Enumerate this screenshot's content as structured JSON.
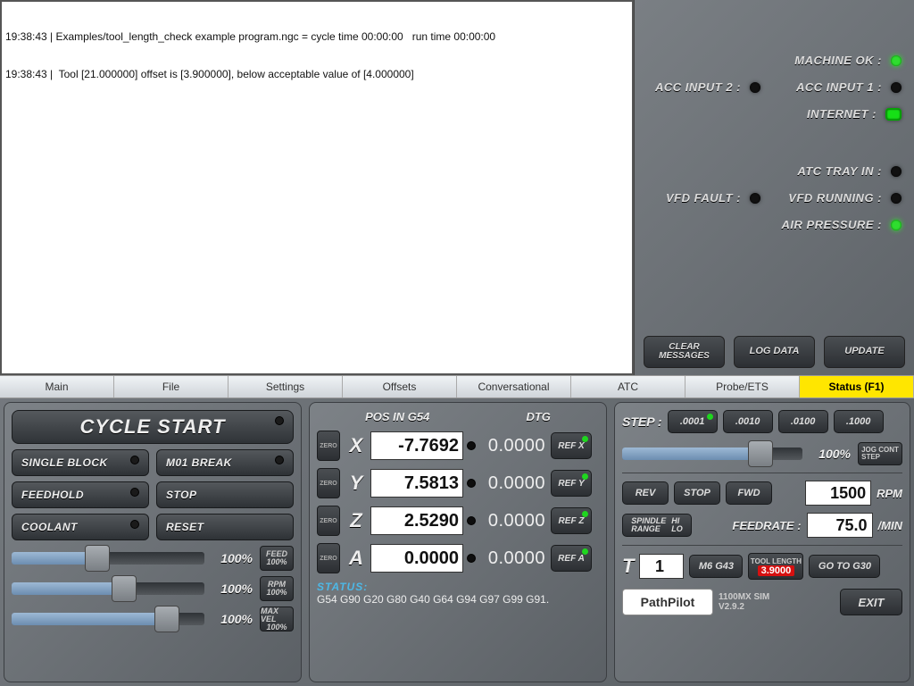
{
  "log": {
    "lines": [
      "19:38:43 | Examples/tool_length_check example program.ngc = cycle time 00:00:00   run time 00:00:00",
      "19:38:43 |  Tool [21.000000] offset is [3.900000], below acceptable value of [4.000000]"
    ]
  },
  "status_leds": {
    "machine_ok": {
      "label": "MACHINE OK :",
      "on": true
    },
    "acc_input_2": {
      "label": "ACC INPUT 2 :",
      "on": false
    },
    "acc_input_1": {
      "label": "ACC INPUT 1 :",
      "on": false
    },
    "internet": {
      "label": "INTERNET :",
      "on": true
    },
    "atc_tray_in": {
      "label": "ATC TRAY IN :",
      "on": false
    },
    "vfd_fault": {
      "label": "VFD FAULT :",
      "on": false
    },
    "vfd_running": {
      "label": "VFD RUNNING :",
      "on": false
    },
    "air_pressure": {
      "label": "AIR PRESSURE :",
      "on": true
    }
  },
  "status_buttons": {
    "clear": "CLEAR\nMESSAGES",
    "log": "LOG DATA",
    "update": "UPDATE"
  },
  "tabs": [
    "Main",
    "File",
    "Settings",
    "Offsets",
    "Conversational",
    "ATC",
    "Probe/ETS",
    "Status (F1)"
  ],
  "active_tab": 7,
  "controls": {
    "cycle_start": "CYCLE START",
    "single_block": "SINGLE BLOCK",
    "m01": "M01 BREAK",
    "feedhold": "FEEDHOLD",
    "stop": "STOP",
    "coolant": "COOLANT",
    "reset": "RESET",
    "feed_pct": "100%",
    "rpm_pct": "100%",
    "maxvel_pct": "100%",
    "feed_tag": "FEED",
    "rpm_tag": "RPM",
    "maxvel_tag": "MAX VEL",
    "hundred": "100%"
  },
  "dro": {
    "pos_label": "POS IN G54",
    "dtg_label": "DTG",
    "axes": [
      {
        "name": "X",
        "pos": "-7.7692",
        "dtg": "0.0000",
        "ref": "REF X"
      },
      {
        "name": "Y",
        "pos": "7.5813",
        "dtg": "0.0000",
        "ref": "REF Y"
      },
      {
        "name": "Z",
        "pos": "2.5290",
        "dtg": "0.0000",
        "ref": "REF Z"
      },
      {
        "name": "A",
        "pos": "0.0000",
        "dtg": "0.0000",
        "ref": "REF A"
      }
    ],
    "status_label": "STATUS:",
    "gcodes": "G54 G90 G20 G80 G40 G64 G94 G97 G99 G91."
  },
  "jog": {
    "step_label": "STEP :",
    "steps": [
      ".0001",
      ".0010",
      ".0100",
      ".1000"
    ],
    "jog_pct": "100%",
    "jog_tag": "JOG CONT\nSTEP",
    "rev": "REV",
    "stop": "STOP",
    "fwd": "FWD",
    "rpm_val": "1500",
    "rpm_unit": "RPM",
    "spindle_range": "SPINDLE\nRANGE",
    "hilo": "HI\nLO",
    "feedrate_label": "FEEDRATE :",
    "feedrate_val": "75.0",
    "feedrate_unit": "/MIN",
    "t_label": "T",
    "t_val": "1",
    "m6g43": "M6 G43",
    "tool_length_label": "TOOL LENGTH",
    "tool_length_val": "3.9000",
    "gotog30": "GO TO G30",
    "exit": "EXIT",
    "product": "1100MX SIM",
    "version": "V2.9.2",
    "logo": "PathPilot"
  }
}
